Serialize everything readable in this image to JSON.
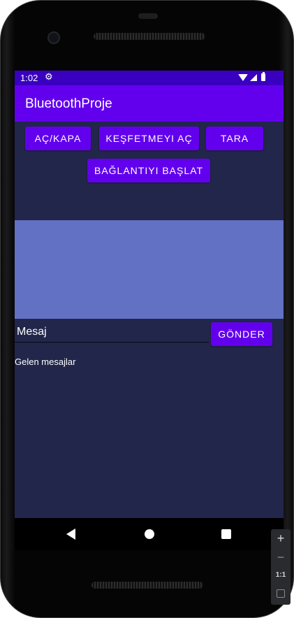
{
  "status_bar": {
    "time": "1:02",
    "settings_icon": "⚙"
  },
  "app_bar": {
    "title": "BluetoothProje"
  },
  "buttons": {
    "toggle": "AÇ/KAPA",
    "discover": "KEŞFETMEYI AÇ",
    "scan": "TARA",
    "connect": "BAĞLANTIYI BAŞLAT",
    "send": "GÖNDER"
  },
  "message": {
    "placeholder": "Mesaj",
    "value": ""
  },
  "incoming": {
    "label": "Gelen mesajlar"
  },
  "zoom": {
    "in": "+",
    "out": "−",
    "reset": "1:1"
  },
  "colors": {
    "status_bar": "#3a00c0",
    "app_bar": "#6200ee",
    "button": "#6200ee",
    "screen_bg": "#22264a",
    "devices_panel": "#6371c4"
  },
  "icons": {
    "status": [
      "gear-icon",
      "wifi-icon",
      "cell-signal-icon",
      "battery-icon"
    ],
    "nav": [
      "back-icon",
      "home-icon",
      "recents-icon"
    ]
  }
}
